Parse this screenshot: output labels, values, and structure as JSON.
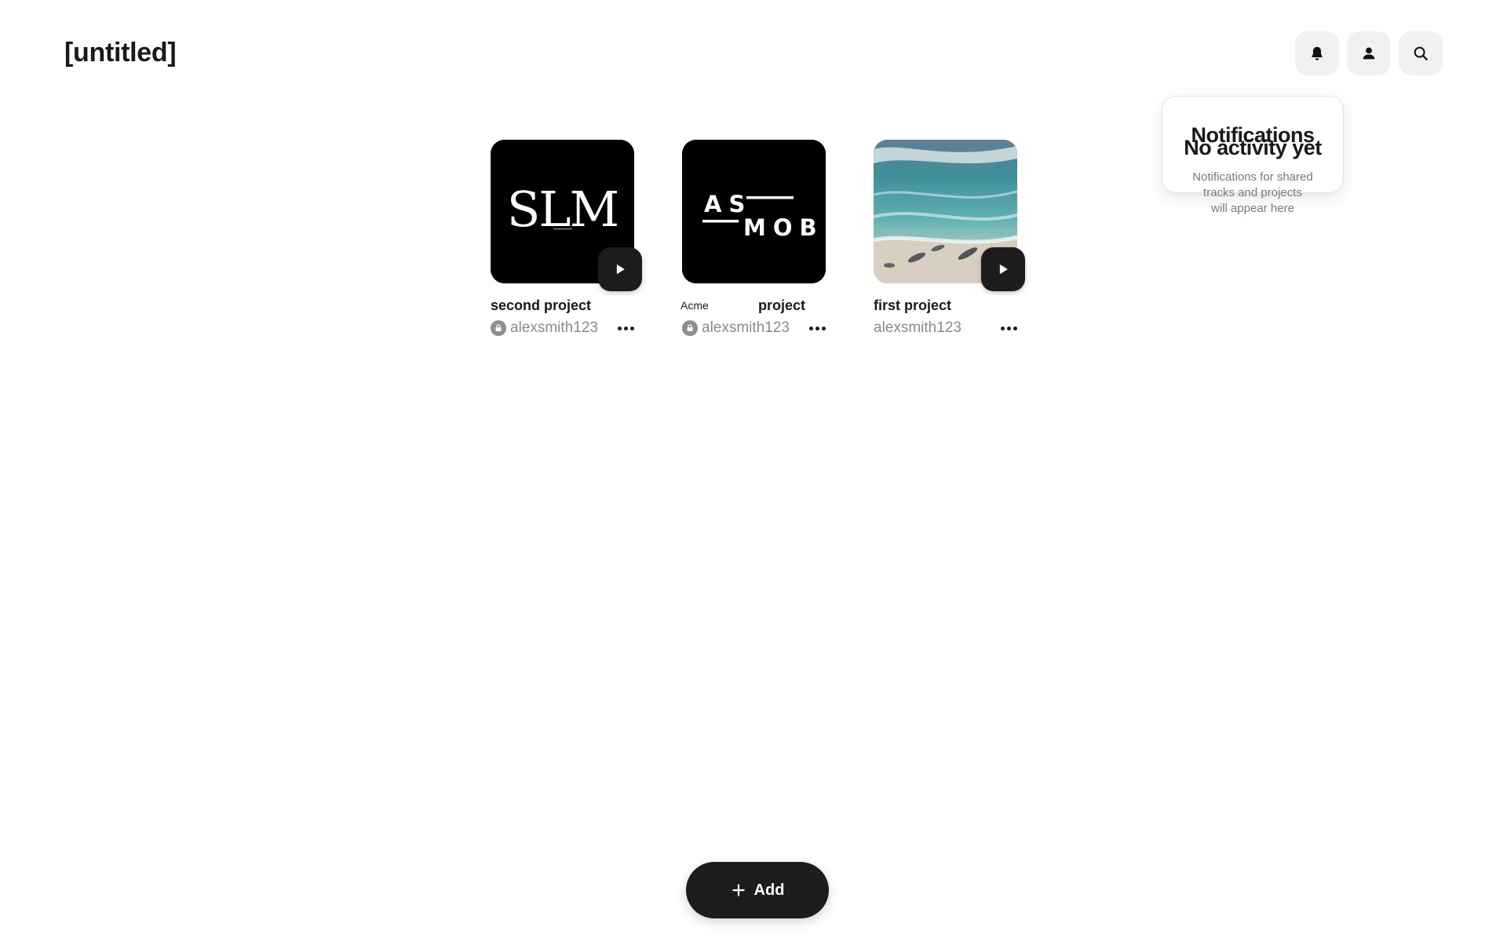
{
  "header": {
    "title": "[untitled]",
    "actions": [
      {
        "name": "notifications",
        "icon": "bell-icon"
      },
      {
        "name": "profile",
        "icon": "user-icon"
      },
      {
        "name": "search",
        "icon": "search-icon"
      }
    ]
  },
  "notifications": {
    "title": "Notifications",
    "heading": "No activity yet",
    "message_line1": "Notifications for shared",
    "message_line2": "tracks and projects",
    "message_line3": "will appear here"
  },
  "projects": [
    {
      "title": "second project",
      "owner": "alexsmith123",
      "private": true,
      "artwork": "SLM"
    },
    {
      "tag": "Acme",
      "title": "project",
      "owner": "alexsmith123",
      "private": true,
      "artwork_line1": "AS",
      "artwork_line2": "MOB"
    },
    {
      "title": "first project",
      "owner": "alexsmith123",
      "private": false,
      "artwork": "aerial-beach-photo"
    }
  ],
  "add_button": {
    "label": "Add"
  },
  "colors": {
    "background": "#ffffff",
    "dark": "#1c1c1c",
    "icon_button_bg": "#f1f1f1",
    "muted_text": "#8a8a8a"
  }
}
